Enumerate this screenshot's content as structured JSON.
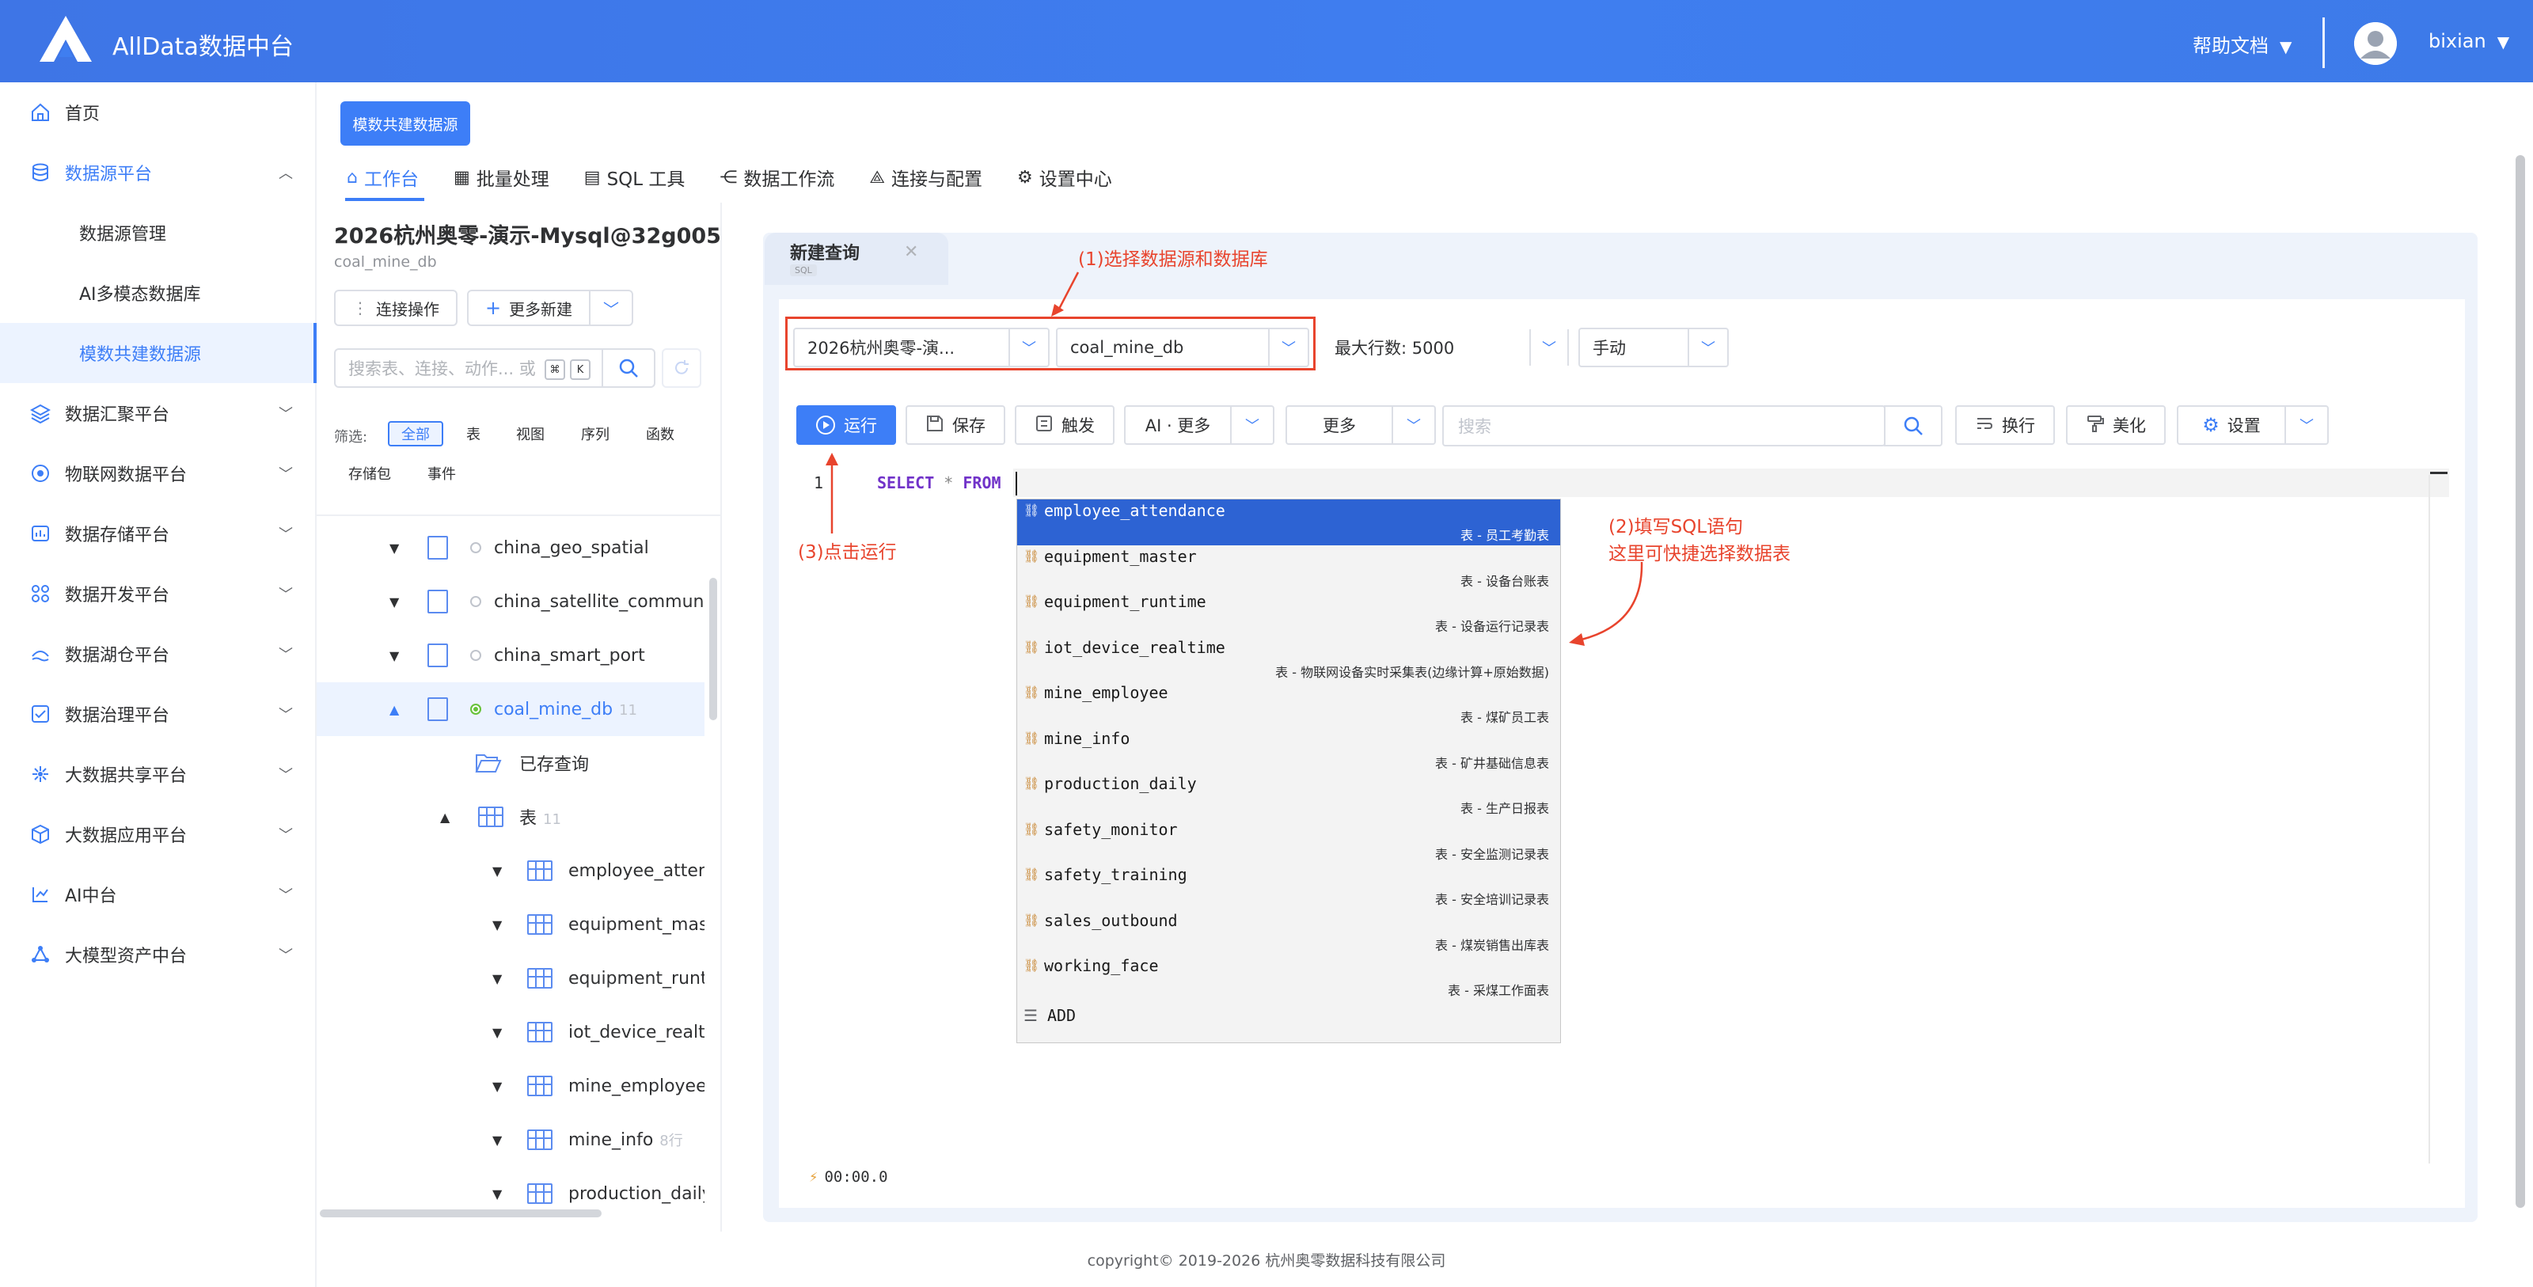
{
  "header": {
    "brand": "AllData数据中台",
    "help": "帮助文档",
    "user": "bixian",
    "dropdown_arrow": "▼"
  },
  "sidebar": {
    "items": [
      {
        "label": "首页",
        "icon": "home-icon"
      },
      {
        "label": "数据源平台",
        "icon": "database-icon",
        "expanded": true
      },
      {
        "label": "数据源管理",
        "sub": true
      },
      {
        "label": "AI多模态数据库",
        "sub": true
      },
      {
        "label": "模数共建数据源",
        "sub": true,
        "selected": true
      },
      {
        "label": "数据汇聚平台",
        "icon": "layers-icon"
      },
      {
        "label": "物联网数据平台",
        "icon": "iot-icon"
      },
      {
        "label": "数据存储平台",
        "icon": "storage-icon"
      },
      {
        "label": "数据开发平台",
        "icon": "grid-icon"
      },
      {
        "label": "数据湖仓平台",
        "icon": "lake-icon"
      },
      {
        "label": "数据治理平台",
        "icon": "check-icon"
      },
      {
        "label": "大数据共享平台",
        "icon": "share-icon"
      },
      {
        "label": "大数据应用平台",
        "icon": "cube-icon"
      },
      {
        "label": "AI中台",
        "icon": "ai-icon"
      },
      {
        "label": "大模型资产中台",
        "icon": "model-icon"
      }
    ]
  },
  "main": {
    "top_button": "模数共建数据源",
    "tabs": [
      {
        "label": "工作台",
        "icon": "⌂"
      },
      {
        "label": "批量处理",
        "icon": "▦"
      },
      {
        "label": "SQL 工具",
        "icon": "▤"
      },
      {
        "label": "数据工作流",
        "icon": "⋲"
      },
      {
        "label": "连接与配置",
        "icon": "⟁"
      },
      {
        "label": "设置中心",
        "icon": "⚙"
      }
    ]
  },
  "dbpanel": {
    "title": "2026杭州奥零-演示-Mysql@32g005",
    "subtitle": "coal_mine_db",
    "connect_btn": "连接操作",
    "new_btn": "更多新建",
    "search_placeholder": "搜索表、连接、动作... 或",
    "kbd1": "⌘",
    "kbd2": "K",
    "filter_label": "筛选:",
    "filters": [
      "全部",
      "表",
      "视图",
      "序列",
      "函数",
      "存储包",
      "事件"
    ],
    "tree": [
      {
        "label": "china_geo_spatial"
      },
      {
        "label": "china_satellite_communication"
      },
      {
        "label": "china_smart_port"
      },
      {
        "label": "coal_mine_db",
        "count": "11"
      },
      {
        "label": "已存查询"
      },
      {
        "label": "表",
        "count": "11"
      },
      {
        "label": "employee_attendance"
      },
      {
        "label": "equipment_master"
      },
      {
        "label": "equipment_runtime"
      },
      {
        "label": "iot_device_realtime"
      },
      {
        "label": "mine_employee"
      },
      {
        "label": "mine_info",
        "count": "8行"
      },
      {
        "label": "production_daily"
      }
    ]
  },
  "editor": {
    "tab_title": "新建查询",
    "tab_badge": "SQL",
    "datasource": "2026杭州奥零-演...",
    "database": "coal_mine_db",
    "max_rows": "最大行数: 5000",
    "mode": "手动",
    "run": "运行",
    "save": "保存",
    "trigger": "触发",
    "ai_more": "AI · 更多",
    "more": "更多",
    "search_placeholder": "搜索",
    "wrap": "换行",
    "beautify": "美化",
    "settings": "设置",
    "line_number": "1",
    "code_select": "SELECT",
    "code_star": "*",
    "code_from": "FROM",
    "timer": "00:00.0",
    "add": "ADD",
    "suggestions": [
      {
        "name": "employee_attendance",
        "desc": "表 - 员工考勤表"
      },
      {
        "name": "equipment_master",
        "desc": "表 - 设备台账表"
      },
      {
        "name": "equipment_runtime",
        "desc": "表 - 设备运行记录表"
      },
      {
        "name": "iot_device_realtime",
        "desc": "表 - 物联网设备实时采集表(边缘计算+原始数据)"
      },
      {
        "name": "mine_employee",
        "desc": "表 - 煤矿员工表"
      },
      {
        "name": "mine_info",
        "desc": "表 - 矿井基础信息表"
      },
      {
        "name": "production_daily",
        "desc": "表 - 生产日报表"
      },
      {
        "name": "safety_monitor",
        "desc": "表 - 安全监测记录表"
      },
      {
        "name": "safety_training",
        "desc": "表 - 安全培训记录表"
      },
      {
        "name": "sales_outbound",
        "desc": "表 - 煤炭销售出库表"
      },
      {
        "name": "working_face",
        "desc": "表 - 采煤工作面表"
      }
    ]
  },
  "annotations": {
    "note1": "(1)选择数据源和数据库",
    "note2a": "(2)填写SQL语句",
    "note2b": "这里可快捷选择数据表",
    "note3": "(3)点击运行"
  },
  "footer": "copyright© 2019-2026 杭州奥零数据科技有限公司",
  "colors": {
    "primary": "#3d7ef7",
    "annotation": "#e8442d",
    "header": "#3f7ef0"
  }
}
